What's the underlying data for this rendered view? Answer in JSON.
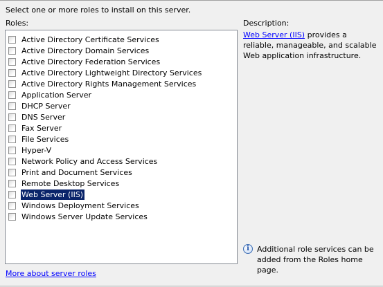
{
  "instruction": "Select one or more roles to install on this server.",
  "roles_label": "Roles:",
  "roles": [
    {
      "label": "Active Directory Certificate Services",
      "checked": false,
      "selected": false
    },
    {
      "label": "Active Directory Domain Services",
      "checked": false,
      "selected": false
    },
    {
      "label": "Active Directory Federation Services",
      "checked": false,
      "selected": false
    },
    {
      "label": "Active Directory Lightweight Directory Services",
      "checked": false,
      "selected": false
    },
    {
      "label": "Active Directory Rights Management Services",
      "checked": false,
      "selected": false
    },
    {
      "label": "Application Server",
      "checked": false,
      "selected": false
    },
    {
      "label": "DHCP Server",
      "checked": false,
      "selected": false
    },
    {
      "label": "DNS Server",
      "checked": false,
      "selected": false
    },
    {
      "label": "Fax Server",
      "checked": false,
      "selected": false
    },
    {
      "label": "File Services",
      "checked": false,
      "selected": false
    },
    {
      "label": "Hyper-V",
      "checked": false,
      "selected": false
    },
    {
      "label": "Network Policy and Access Services",
      "checked": false,
      "selected": false
    },
    {
      "label": "Print and Document Services",
      "checked": false,
      "selected": false
    },
    {
      "label": "Remote Desktop Services",
      "checked": false,
      "selected": false
    },
    {
      "label": "Web Server (IIS)",
      "checked": false,
      "selected": true
    },
    {
      "label": "Windows Deployment Services",
      "checked": false,
      "selected": false
    },
    {
      "label": "Windows Server Update Services",
      "checked": false,
      "selected": false
    }
  ],
  "description": {
    "heading": "Description:",
    "link_text": "Web Server (IIS)",
    "text": " provides a reliable, manageable, and scalable Web application infrastructure."
  },
  "info": {
    "icon": "info-icon",
    "text": "Additional role services can be added from the Roles home page."
  },
  "more_link": "More about server roles",
  "colors": {
    "background": "#f0f0f0",
    "link": "#0000ff",
    "selection": "#0a246a",
    "list_border": "#828790"
  }
}
